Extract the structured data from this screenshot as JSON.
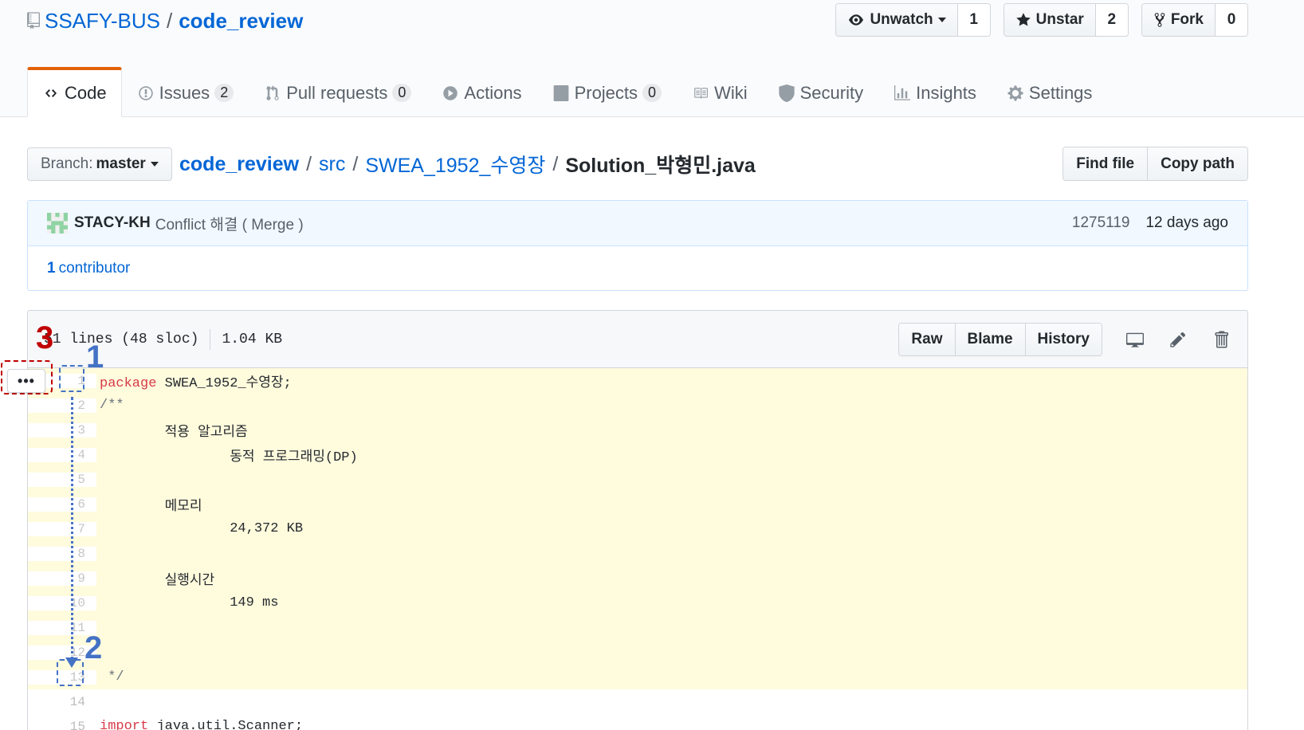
{
  "repo": {
    "owner": "SSAFY-BUS",
    "separator": "/",
    "name": "code_review"
  },
  "actions": {
    "watch": {
      "label": "Unwatch",
      "count": "1"
    },
    "star": {
      "label": "Unstar",
      "count": "2"
    },
    "fork": {
      "label": "Fork",
      "count": "0"
    }
  },
  "nav": {
    "code": "Code",
    "issues": "Issues",
    "issues_count": "2",
    "pulls": "Pull requests",
    "pulls_count": "0",
    "actions": "Actions",
    "projects": "Projects",
    "projects_count": "0",
    "wiki": "Wiki",
    "security": "Security",
    "insights": "Insights",
    "settings": "Settings"
  },
  "branch": {
    "label": "Branch:",
    "value": "master"
  },
  "breadcrumb": [
    "code_review",
    "src",
    "SWEA_1952_수영장",
    "Solution_박형민.java"
  ],
  "file_nav": {
    "find": "Find file",
    "copy": "Copy path"
  },
  "commit": {
    "author": "STACY-KH",
    "message": "Conflict 해결 ( Merge )",
    "sha": "1275119",
    "ago": "12 days ago"
  },
  "contributors": {
    "count": "1",
    "label": "contributor"
  },
  "file": {
    "lines": "51 lines (48 sloc)",
    "size": "1.04 KB",
    "raw": "Raw",
    "blame": "Blame",
    "history": "History"
  },
  "code_lines": [
    {
      "n": "1",
      "kw": "package",
      "text": " SWEA_1952_수영장;"
    },
    {
      "n": "2",
      "text": "/**"
    },
    {
      "n": "3",
      "text": "        적용 알고리즘"
    },
    {
      "n": "4",
      "text": "                동적 프로그래밍(DP)"
    },
    {
      "n": "5",
      "text": ""
    },
    {
      "n": "6",
      "text": "        메모리"
    },
    {
      "n": "7",
      "text": "                24,372 KB"
    },
    {
      "n": "8",
      "text": ""
    },
    {
      "n": "9",
      "text": "        실행시간"
    },
    {
      "n": "10",
      "text": "                149 ms"
    },
    {
      "n": "11",
      "text": ""
    },
    {
      "n": "12",
      "text": ""
    },
    {
      "n": "13",
      "text": " */"
    },
    {
      "n": "14",
      "text": ""
    },
    {
      "n": "15",
      "kw": "import",
      "text": " java.util.Scanner;"
    }
  ],
  "annotations": {
    "one": "1",
    "two": "2",
    "three": "3",
    "dots": "•••"
  },
  "colors": {
    "highlight": "#fffbdd",
    "link": "#0366d6",
    "annotation_blue": "#4472c4",
    "annotation_red": "#c00000",
    "tab_accent": "#e36209"
  }
}
